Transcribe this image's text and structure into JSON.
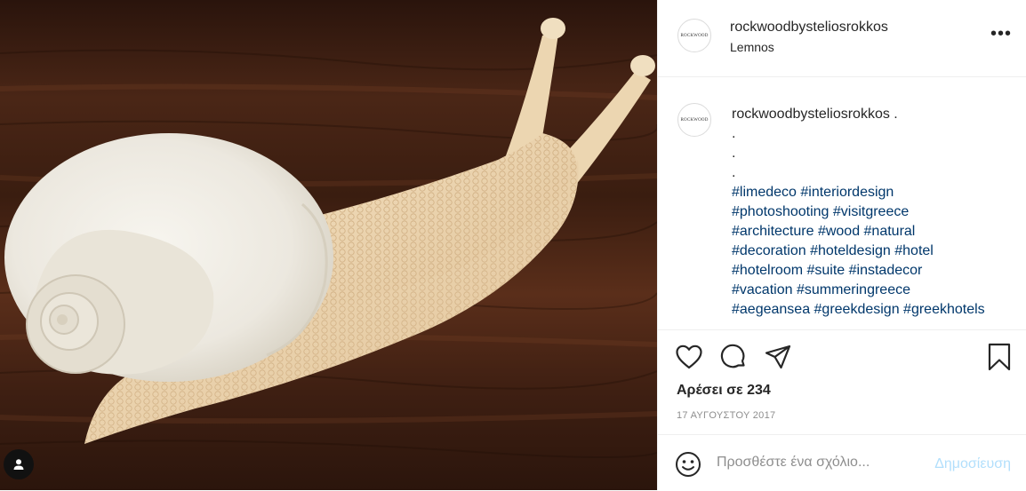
{
  "photo": {
    "alt_icon": "snail-photo",
    "tag_icon": "user-tag-icon"
  },
  "header": {
    "avatar_text": "ROCKWOOD",
    "username": "rockwoodbysteliosrokkos",
    "location": "Lemnos",
    "more_label": "•••"
  },
  "caption": {
    "avatar_text": "ROCKWOOD",
    "username": "rockwoodbysteliosrokkos",
    "first_text": " .",
    "dots": [
      ".",
      ".",
      "."
    ],
    "hashtag_lines": [
      "#limedeco #interiordesign",
      "#photoshooting #visitgreece",
      "#architecture #wood #natural",
      "#decoration #hoteldesign #hotel",
      "#hotelroom #suite #instadecor",
      "#vacation #summeringreece",
      "#aegeansea #greekdesign #greekhotels"
    ]
  },
  "actions": {
    "like_icon": "heart-icon",
    "comment_icon": "comment-icon",
    "share_icon": "share-icon",
    "save_icon": "bookmark-icon",
    "likes_text": "Αρέσει σε 234",
    "date": "17 ΑΥΓΟΥΣΤΟΥ 2017"
  },
  "add_comment": {
    "placeholder": "Προσθέστε ένα σχόλιο...",
    "post_label": "Δημοσίευση"
  },
  "colors": {
    "hashtag": "#00376b",
    "post_disabled": "#b2dffc",
    "muted": "#8e8e8e",
    "border": "#efefef"
  }
}
